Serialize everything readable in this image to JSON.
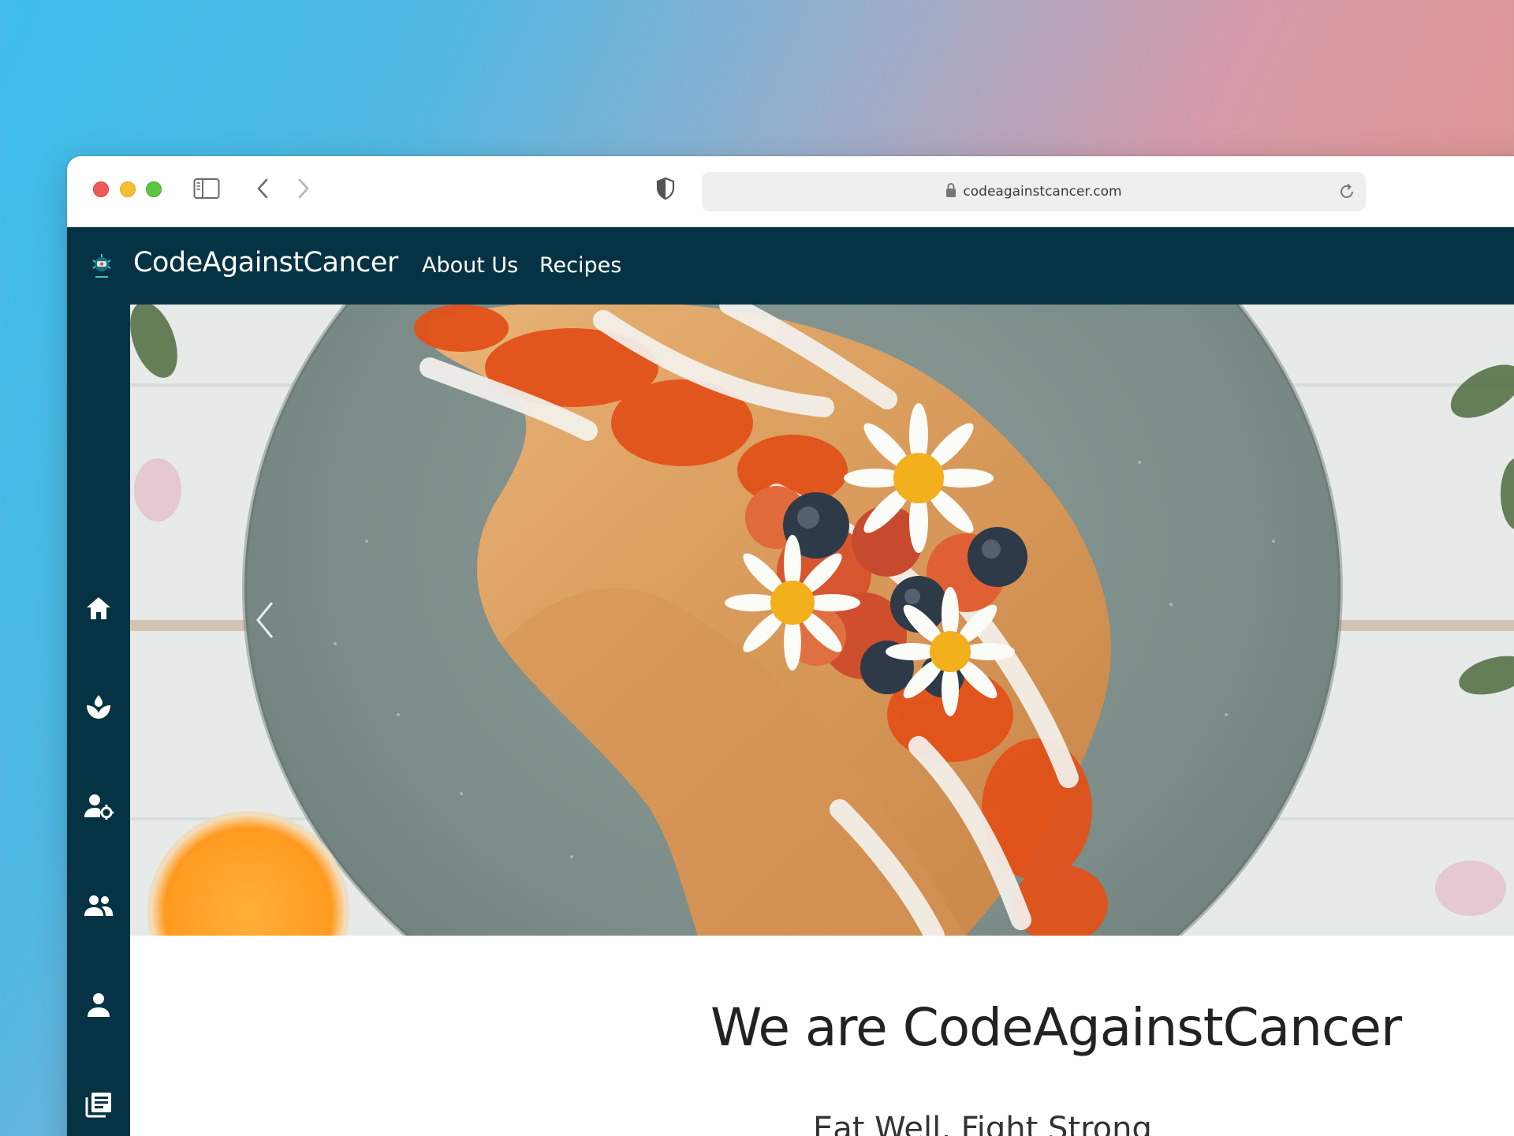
{
  "browser": {
    "url": "codeagainstcancer.com",
    "icons": [
      "close-dot",
      "minimize-dot",
      "zoom-dot",
      "sidebar-toggle-icon",
      "back-chevron-icon",
      "forward-chevron-icon",
      "privacy-shield-icon",
      "lock-icon",
      "reload-icon"
    ]
  },
  "site": {
    "brand": "CodeAgainstCancer",
    "nav": {
      "about": "About Us",
      "recipes": "Recipes"
    },
    "sidebar_icons": [
      "home-icon",
      "plant-icon",
      "user-settings-icon",
      "group-icon",
      "person-icon",
      "newspaper-icon"
    ],
    "headline": "We are CodeAgainstCancer",
    "subheadline": "Eat Well, Fight Strong"
  },
  "colors": {
    "nav_bg": "#053344",
    "text_dark": "#222222"
  }
}
